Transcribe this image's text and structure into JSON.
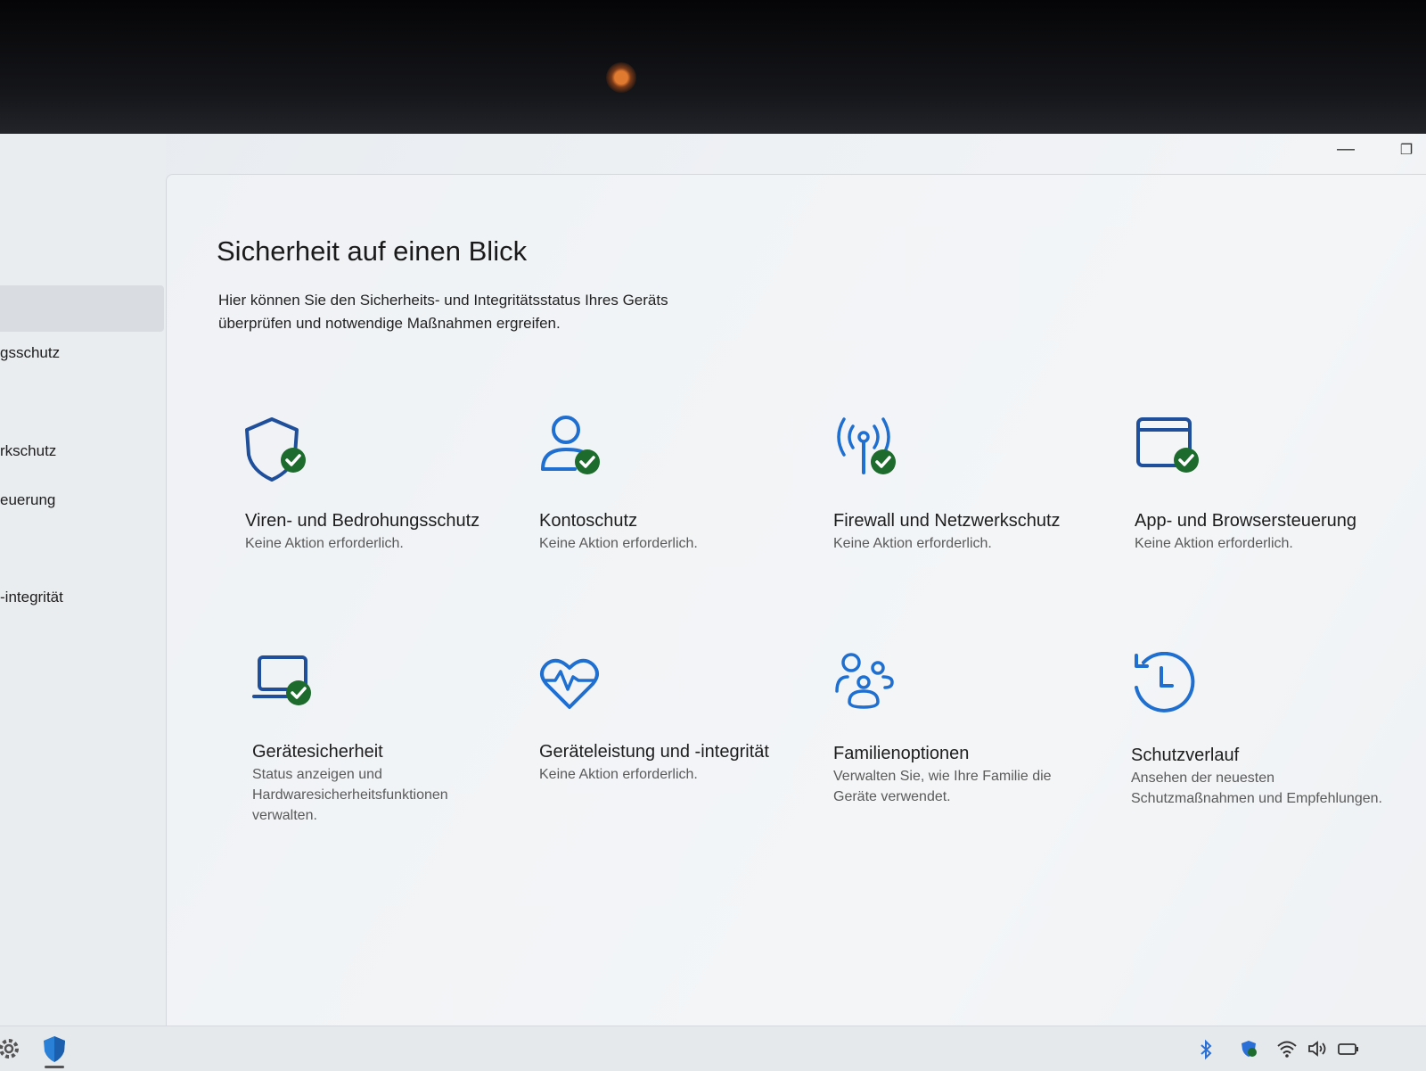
{
  "window": {
    "minimize_glyph": "—",
    "maximize_glyph": "❐"
  },
  "sidebar": {
    "items": [
      {
        "label": "gsschutz"
      },
      {
        "label": "rkschutz"
      },
      {
        "label": "euerung"
      },
      {
        "label": "-integrität"
      }
    ]
  },
  "main": {
    "title": "Sicherheit auf einen Blick",
    "description": "Hier können Sie den Sicherheits- und Integritätsstatus Ihres Geräts überprüfen und notwendige Maßnahmen ergreifen.",
    "tiles": [
      {
        "title": "Viren- und Bedrohungsschutz",
        "status": "Keine Aktion erforderlich.",
        "icon": "shield-check-icon"
      },
      {
        "title": "Kontoschutz",
        "status": "Keine Aktion erforderlich.",
        "icon": "account-check-icon"
      },
      {
        "title": "Firewall und Netzwerkschutz",
        "status": "Keine Aktion erforderlich.",
        "icon": "antenna-check-icon"
      },
      {
        "title": "App- und Browsersteuerung",
        "status": "Keine Aktion erforderlich.",
        "icon": "browser-window-check-icon"
      },
      {
        "title": "Gerätesicherheit",
        "status": "Status anzeigen und Hardwaresicherheitsfunktionen verwalten.",
        "icon": "laptop-check-icon"
      },
      {
        "title": "Geräteleistung und -integrität",
        "status": "Keine Aktion erforderlich.",
        "icon": "heart-pulse-icon"
      },
      {
        "title": "Familienoptionen",
        "status": "Verwalten Sie, wie Ihre Familie die Geräte verwendet.",
        "icon": "family-icon"
      },
      {
        "title": "Schutzverlauf",
        "status": "Ansehen der neuesten Schutzmaßnahmen und Empfehlungen.",
        "icon": "history-clock-icon"
      }
    ]
  },
  "colors": {
    "accent": "#1f6fd1",
    "check_badge": "#1e6b2e"
  }
}
